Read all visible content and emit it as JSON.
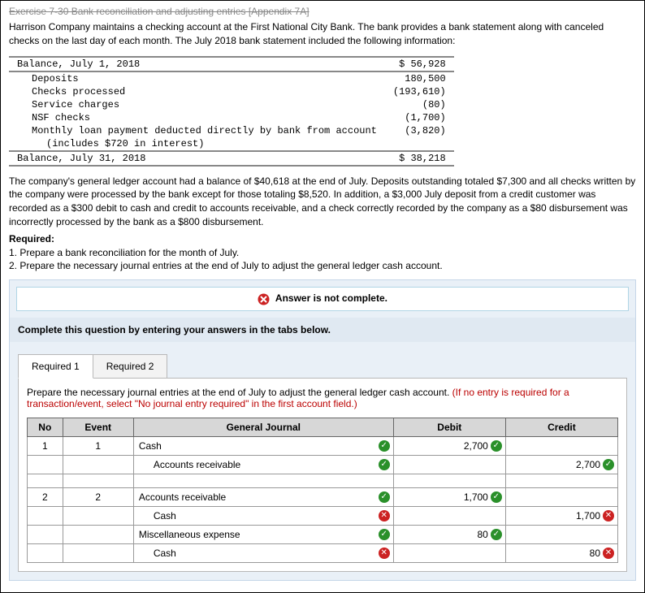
{
  "top": "Exercise 7-30 Bank reconciliation and adjusting entries [Appendix 7A]",
  "intro": "Harrison Company maintains a checking account at the First National City Bank. The bank provides a bank statement along with canceled checks on the last day of each month. The July 2018 bank statement included the following information:",
  "stmt": [
    {
      "l": "Balance, July 1, 2018",
      "a": "$ 56,928",
      "b": true
    },
    {
      "l": "Deposits",
      "a": "180,500",
      "ind": true
    },
    {
      "l": "Checks processed",
      "a": "(193,610)",
      "ind": true
    },
    {
      "l": "Service charges",
      "a": "(80)",
      "ind": true
    },
    {
      "l": "NSF checks",
      "a": "(1,700)",
      "ind": true
    },
    {
      "l": "Monthly loan payment deducted directly by bank from account",
      "a": "(3,820)",
      "ind": true
    },
    {
      "l": "(includes $720 in interest)",
      "a": "",
      "ind2": true
    },
    {
      "l": "Balance, July 31, 2018",
      "a": "$ 38,218",
      "b": true
    }
  ],
  "para2": "The company's general ledger account had a balance of $40,618 at the end of July. Deposits outstanding totaled $7,300 and all checks written by the company were processed by the bank except for those totaling $8,520. In addition, a $3,000 July deposit from a credit customer was recorded as a $300 debit to cash and credit to accounts receivable, and a check correctly recorded by the company as a $80 disbursement was incorrectly processed by the bank as a $800 disbursement.",
  "req_t": "Required:",
  "req1": "1. Prepare a bank reconciliation for the month of July.",
  "req2": "2. Prepare the necessary journal entries at the end of July to adjust the general ledger cash account.",
  "alert": "Answer is not complete.",
  "instr": "Complete this question by entering your answers in the tabs below.",
  "tab1": "Required 1",
  "tab2": "Required 2",
  "note1": "Prepare the necessary journal entries at the end of July to adjust the general ledger cash account. ",
  "note2": "(If no entry is required for a transaction/event, select \"No journal entry required\" in the first account field.)",
  "h": {
    "no": "No",
    "event": "Event",
    "gj": "General Journal",
    "d": "Debit",
    "c": "Credit"
  },
  "r": [
    {
      "no": "1",
      "ev": "1",
      "acc": "Cash",
      "aind": 0,
      "d": "2,700",
      "di": "ok",
      "c": "",
      "ci": "",
      "gi": "ok"
    },
    {
      "no": "",
      "ev": "",
      "acc": "Accounts receivable",
      "aind": 1,
      "d": "",
      "di": "",
      "c": "2,700",
      "ci": "ok",
      "gi": "ok"
    },
    {
      "sp": true
    },
    {
      "no": "2",
      "ev": "2",
      "acc": "Accounts receivable",
      "aind": 0,
      "d": "1,700",
      "di": "ok",
      "c": "",
      "ci": "",
      "gi": "ok"
    },
    {
      "no": "",
      "ev": "",
      "acc": "Cash",
      "aind": 1,
      "d": "",
      "di": "",
      "c": "1,700",
      "ci": "no",
      "gi": "no"
    },
    {
      "no": "",
      "ev": "",
      "acc": "Miscellaneous expense",
      "aind": 0,
      "d": "80",
      "di": "ok",
      "c": "",
      "ci": "",
      "gi": "ok"
    },
    {
      "no": "",
      "ev": "",
      "acc": "Cash",
      "aind": 1,
      "d": "",
      "di": "",
      "c": "80",
      "ci": "no",
      "gi": "no"
    }
  ]
}
